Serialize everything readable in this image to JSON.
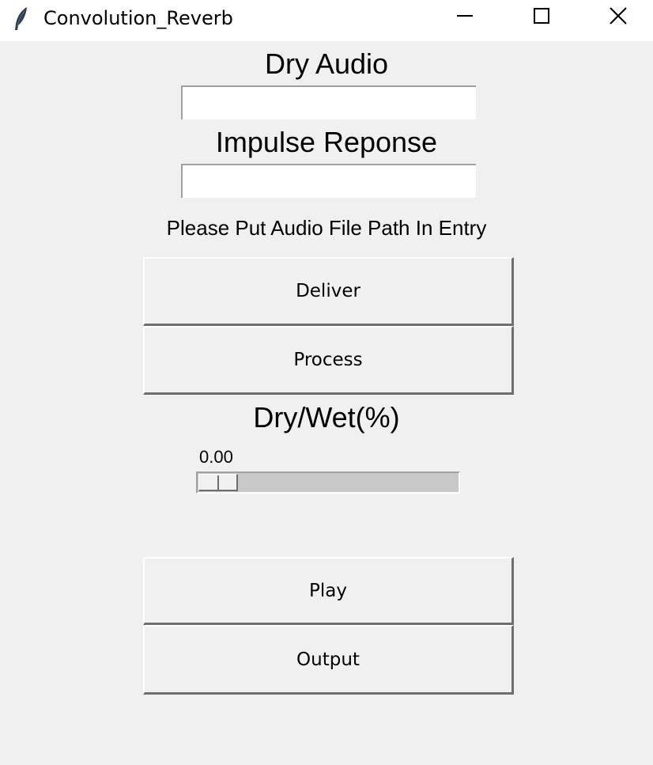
{
  "window": {
    "title": "Convolution_Reverb",
    "icon": "feather-icon"
  },
  "dry_audio": {
    "label": "Dry Audio",
    "value": ""
  },
  "impulse_response": {
    "label": "Impulse Reponse",
    "value": ""
  },
  "instruction": "Please Put Audio File Path In Entry",
  "buttons": {
    "deliver": "Deliver",
    "process": "Process",
    "play": "Play",
    "output": "Output"
  },
  "dry_wet": {
    "label": "Dry/Wet(%)",
    "value_text": "0.00",
    "value": 0
  },
  "colors": {
    "background": "#f0f0f0",
    "titlebar": "#ffffff",
    "trough": "#c8c8c8"
  }
}
